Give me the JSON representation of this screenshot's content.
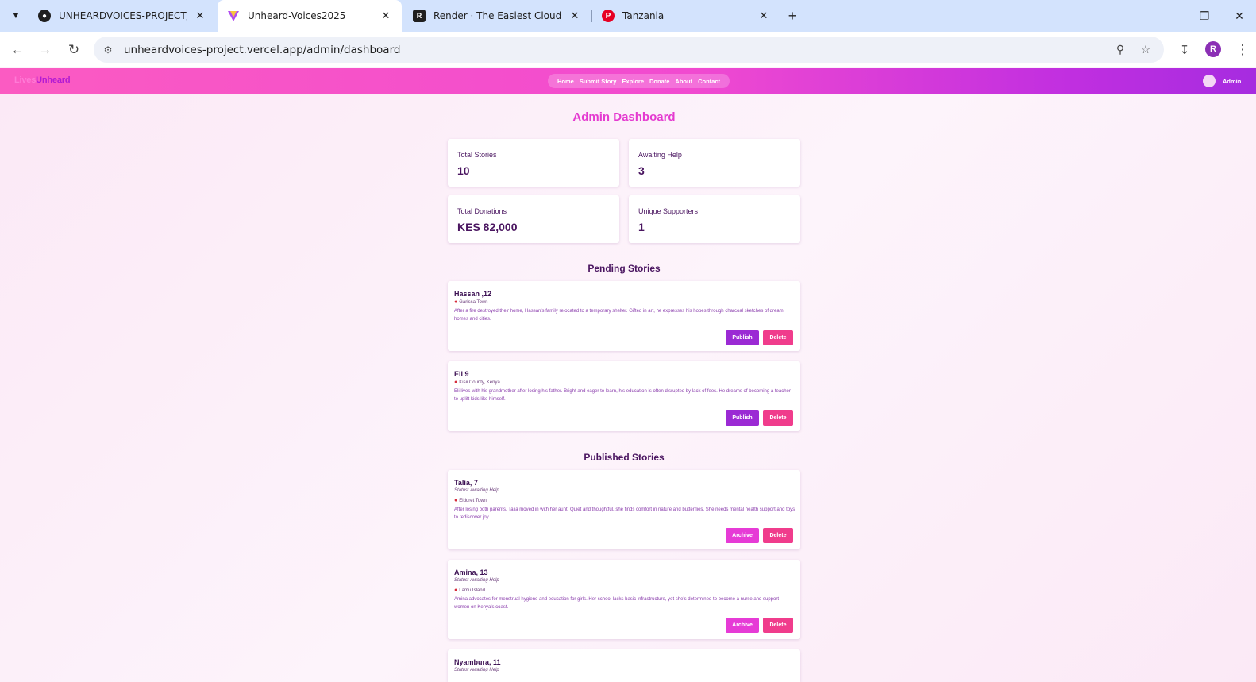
{
  "browser": {
    "tabs": [
      {
        "title": "UNHEARDVOICES-PROJECT/ at",
        "icon": "github-icon"
      },
      {
        "title": "Unheard-Voices2025",
        "icon": "vercel-icon"
      },
      {
        "title": "Render · The Easiest Cloud For /",
        "icon": "render-icon"
      },
      {
        "title": "Tanzania",
        "icon": "pinterest-icon"
      }
    ],
    "url": "unheardvoices-project.vercel.app/admin/dashboard",
    "profile_initial": "R"
  },
  "site": {
    "logo_part1": "Lives",
    "logo_part2": "Unheard",
    "nav": [
      "Home",
      "Submit Story",
      "Explore",
      "Donate",
      "About",
      "Contact"
    ],
    "user_label": "Admin",
    "colors": {
      "accent": "#e43ad0",
      "publish": "#9b2ad4",
      "delete": "#f03c8c",
      "archive": "#e63bd6"
    }
  },
  "dashboard": {
    "title": "Admin Dashboard",
    "stats": [
      {
        "label": "Total Stories",
        "value": "10"
      },
      {
        "label": "Awaiting Help",
        "value": "3"
      },
      {
        "label": "Total Donations",
        "value": "KES 82,000"
      },
      {
        "label": "Unique Supporters",
        "value": "1"
      }
    ],
    "pending_title": "Pending Stories",
    "pending": [
      {
        "name": "Hassan ,12",
        "location": "Garissa Town",
        "description": "After a fire destroyed their home, Hassan's family relocated to a temporary shelter. Gifted in art, he expresses his hopes through charcoal sketches of dream homes and cities.",
        "publish_label": "Publish",
        "delete_label": "Delete"
      },
      {
        "name": "Eli 9",
        "location": "Kisii County, Kenya",
        "description": "Eli lives with his grandmother after losing his father. Bright and eager to learn, his education is often disrupted by lack of fees. He dreams of becoming a teacher to uplift kids like himself.",
        "publish_label": "Publish",
        "delete_label": "Delete"
      }
    ],
    "published_title": "Published Stories",
    "published": [
      {
        "name": "Talia, 7",
        "status": "Status: Awaiting Help",
        "location": "Eldoret Town",
        "description": "After losing both parents, Talia moved in with her aunt. Quiet and thoughtful, she finds comfort in nature and butterflies. She needs mental health support and toys to rediscover joy.",
        "archive_label": "Archive",
        "delete_label": "Delete"
      },
      {
        "name": "Amina, 13",
        "status": "Status: Awaiting Help",
        "location": "Lamu Island",
        "description": "Amina advocates for menstrual hygiene and education for girls. Her school lacks basic infrastructure, yet she's determined to become a nurse and support women on Kenya's coast.",
        "archive_label": "Archive",
        "delete_label": "Delete"
      },
      {
        "name": "Nyambura, 11",
        "status": "Status: Awaiting Help"
      }
    ]
  }
}
